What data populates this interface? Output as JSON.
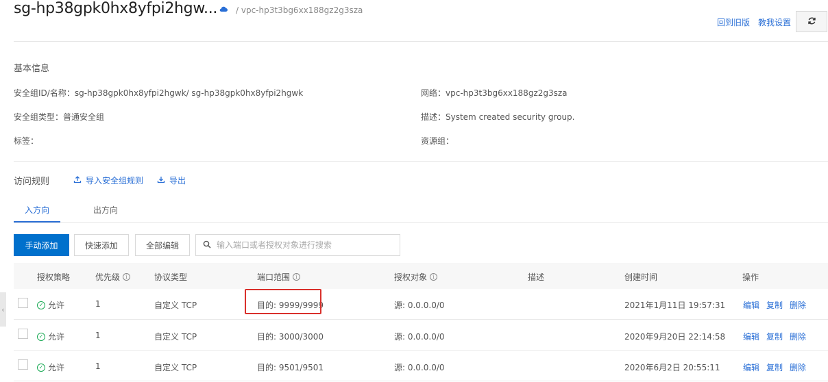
{
  "header": {
    "title": "sg-hp38gpk0hx8yfpi2hgw...",
    "breadcrumb": "/ vpc-hp3t3bg6xx188gz2g3sza",
    "back_old": "回到旧版",
    "tutorial": "教我设置",
    "cloud_icon": "cloud-icon",
    "refresh_icon": "refresh-icon"
  },
  "basic": {
    "title": "基本信息",
    "sg_id": "安全组ID/名称：sg-hp38gpk0hx8yfpi2hgwk/ sg-hp38gpk0hx8yfpi2hgwk",
    "sg_type": "安全组类型：普通安全组",
    "tags": "标签：",
    "network": "网络：vpc-hp3t3bg6xx188gz2g3sza",
    "desc": "描述：System created security group.",
    "resource_group": "资源组："
  },
  "rules": {
    "title": "访问规则",
    "import": "导入安全组规则",
    "export": "导出",
    "tabs": [
      "入方向",
      "出方向"
    ],
    "btn_manual": "手动添加",
    "btn_quick": "快速添加",
    "btn_edit_all": "全部编辑",
    "search_placeholder": "输入端口或者授权对象进行搜索"
  },
  "table": {
    "headers": [
      "授权策略",
      "优先级",
      "协议类型",
      "端口范围",
      "授权对象",
      "描述",
      "创建时间",
      "操作"
    ],
    "rows": [
      {
        "policy": "允许",
        "priority": "1",
        "protocol": "自定义 TCP",
        "port": "目的: 9999/9999",
        "source": "源: 0.0.0.0/0",
        "created": "2021年1月11日 19:57:31"
      },
      {
        "policy": "允许",
        "priority": "1",
        "protocol": "自定义 TCP",
        "port": "目的: 3000/3000",
        "source": "源: 0.0.0.0/0",
        "created": "2020年9月20日 22:14:58"
      },
      {
        "policy": "允许",
        "priority": "1",
        "protocol": "自定义 TCP",
        "port": "目的: 9501/9501",
        "source": "源: 0.0.0.0/0",
        "created": "2020年6月2日 20:55:11"
      }
    ],
    "ops": [
      "编辑",
      "复制",
      "删除"
    ]
  },
  "colors": {
    "accent": "#2a6fd6",
    "primary_button": "#0070cc",
    "allow": "#1aaa55",
    "highlight": "#d9302b"
  }
}
